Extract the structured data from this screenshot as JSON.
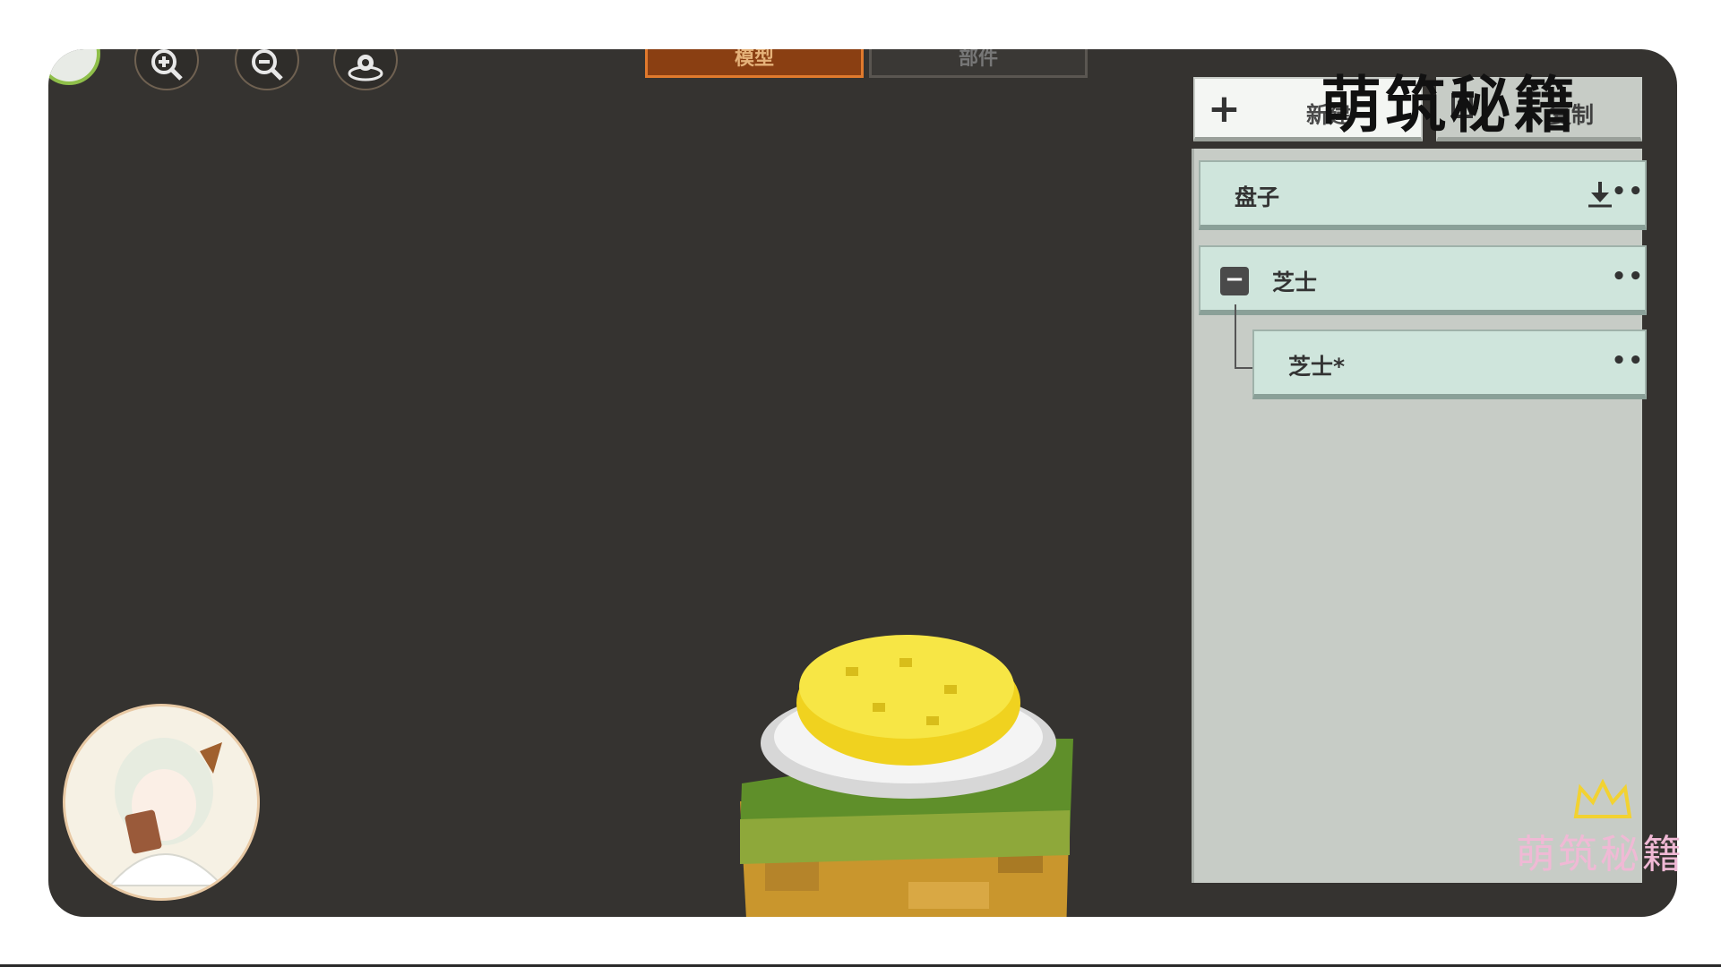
{
  "tabs": [
    {
      "label": "模型"
    },
    {
      "label": "部件"
    }
  ],
  "toolbar": {
    "zoom_in_icon": "zoom-in-icon",
    "zoom_out_icon": "zoom-out-icon",
    "camera_icon": "camera-reset-icon"
  },
  "panel": {
    "new_label": "新建",
    "copy_label": "复制",
    "items": [
      {
        "label": "盘子"
      },
      {
        "label": "芝士"
      },
      {
        "label": "芝士*"
      }
    ],
    "more_glyph": "••"
  },
  "watermark": {
    "top": "萌筑秘籍",
    "bottom": "萌筑秘籍"
  },
  "colors": {
    "viewport_bg": "#353330",
    "panel_bg": "#c7ccc6",
    "item_bg": "#cfe5dc",
    "active_tab": "#8a3f12",
    "cheese": "#f5e03a",
    "grass": "#5f8f2a",
    "dirt": "#c9962d"
  }
}
